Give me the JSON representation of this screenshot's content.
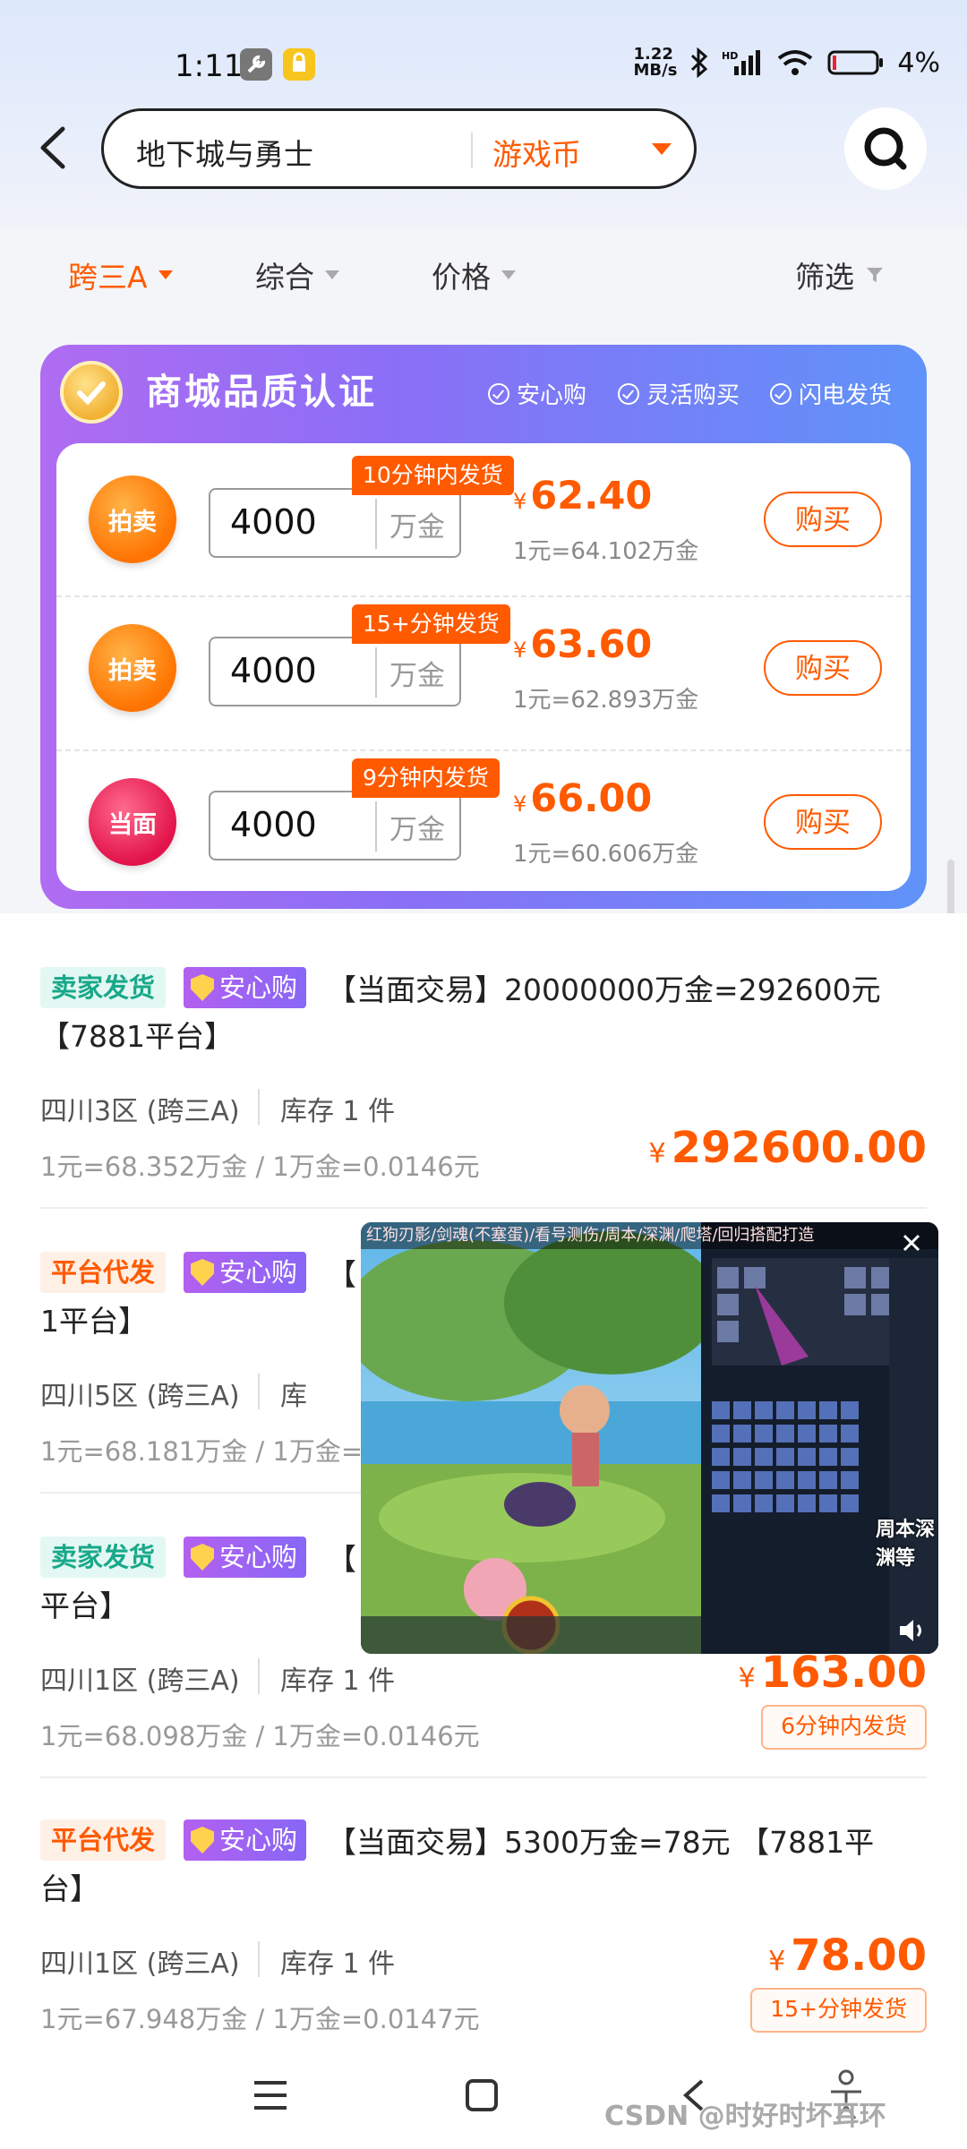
{
  "status_bar": {
    "time": "1:11",
    "net_speed": "1.22\nMB/s",
    "battery": "4%"
  },
  "header": {
    "search_text": "地下城与勇士",
    "category": "游戏币"
  },
  "filters": {
    "server": "跨三A",
    "sort": "综合",
    "price": "价格",
    "filter": "筛选"
  },
  "mall": {
    "title": "商城品质认证",
    "features": [
      "安心购",
      "灵活购买",
      "闪电发货"
    ],
    "offers": [
      {
        "seal": "拍卖",
        "qty": "4000",
        "unit": "万金",
        "tag": "10分钟内发货",
        "currency": "¥",
        "price": "62.40",
        "rate": "1元=64.102万金",
        "buy": "购买"
      },
      {
        "seal": "拍卖",
        "qty": "4000",
        "unit": "万金",
        "tag": "15+分钟发货",
        "currency": "¥",
        "price": "63.60",
        "rate": "1元=62.893万金",
        "buy": "购买"
      },
      {
        "seal": "当面",
        "qty": "4000",
        "unit": "万金",
        "tag": "9分钟内发货",
        "currency": "¥",
        "price": "66.00",
        "rate": "1元=60.606万金",
        "buy": "购买"
      }
    ]
  },
  "listings": [
    {
      "tag": "卖家发货",
      "badge": "安心购",
      "title_line1": "【当面交易】20000000万金=292600元",
      "title_line2": "【7881平台】",
      "server": "四川3区 (跨三A)",
      "stock": "库存 1 件",
      "rate": "1元=68.352万金 / 1万金=0.0146元",
      "currency": "¥",
      "price": "292600.00",
      "delivery": ""
    },
    {
      "tag": "平台代发",
      "badge": "安心购",
      "title_line1": "【",
      "title_line2": "1平台】",
      "server": "四川5区 (跨三A)",
      "stock": "库",
      "rate": "1元=68.181万金 / 1万金=0.",
      "currency": "",
      "price": "",
      "delivery": ""
    },
    {
      "tag": "卖家发货",
      "badge": "安心购",
      "title_line1": "【",
      "title_line2": "平台】",
      "server": "四川1区 (跨三A)",
      "stock": "库存 1 件",
      "rate": "1元=68.098万金 / 1万金=0.0146元",
      "currency": "¥",
      "price": "163.00",
      "delivery": "6分钟内发货"
    },
    {
      "tag": "平台代发",
      "badge": "安心购",
      "title_line1": "【当面交易】5300万金=78元 【7881平",
      "title_line2": "台】",
      "server": "四川1区 (跨三A)",
      "stock": "库存 1 件",
      "rate": "1元=67.948万金 / 1万金=0.0147元",
      "currency": "¥",
      "price": "78.00",
      "delivery": "15+分钟发货"
    }
  ],
  "video_overlay": {
    "caption": "红狗刃影/剑魂(不塞蛋)/看号测伤/周本/深渊/爬塔/回归搭配打造",
    "overlay_text": "周本深渊等"
  },
  "watermark": "CSDN @时好时坏耳环",
  "colors": {
    "accent": "#ff5a00",
    "mall_gradient_start": "#b06cf2",
    "mall_gradient_end": "#5f93f9",
    "seller_tag": "#18a88a"
  }
}
